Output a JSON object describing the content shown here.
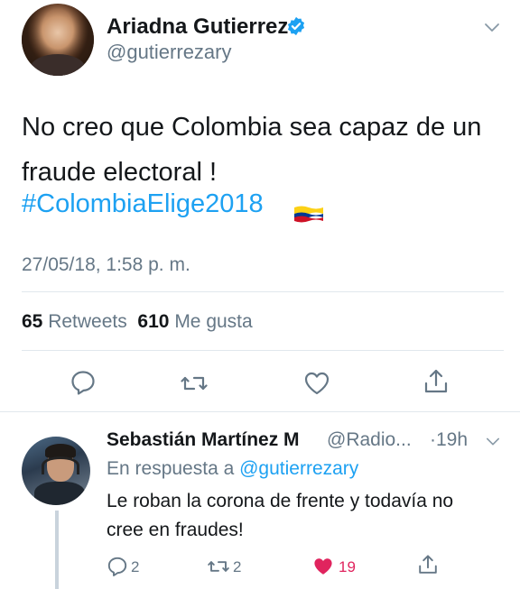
{
  "tweet": {
    "author_name": "Ariadna Gutierrez",
    "author_handle": "@gutierrezary",
    "text": "No creo que Colombia sea capaz de un fraude electoral !",
    "hashtag": "#ColombiaElige2018",
    "timestamp": "27/05/18, 1:58 p. m.",
    "retweet_count": "65",
    "retweet_label": "Retweets",
    "like_count": "610",
    "like_label": "Me gusta",
    "icons": [
      "comment-icon",
      "retweet-icon",
      "heart-icon",
      "share-icon"
    ]
  },
  "reply": {
    "author_name": "Sebastián Martínez M",
    "author_handle": "@Radio...",
    "time": "·19h",
    "in_reply_prefix": "En respuesta a",
    "in_reply_handle": "@gutierrezary",
    "text": "Le roban la corona de frente y todavía no cree en fraudes!",
    "reply_count": "2",
    "retweet_count": "2",
    "like_count": "19"
  },
  "colors": {
    "link_blue": "#1da1f2",
    "muted_gray": "#657786",
    "like_pink": "#e0245e",
    "text_dark": "#14171a"
  }
}
